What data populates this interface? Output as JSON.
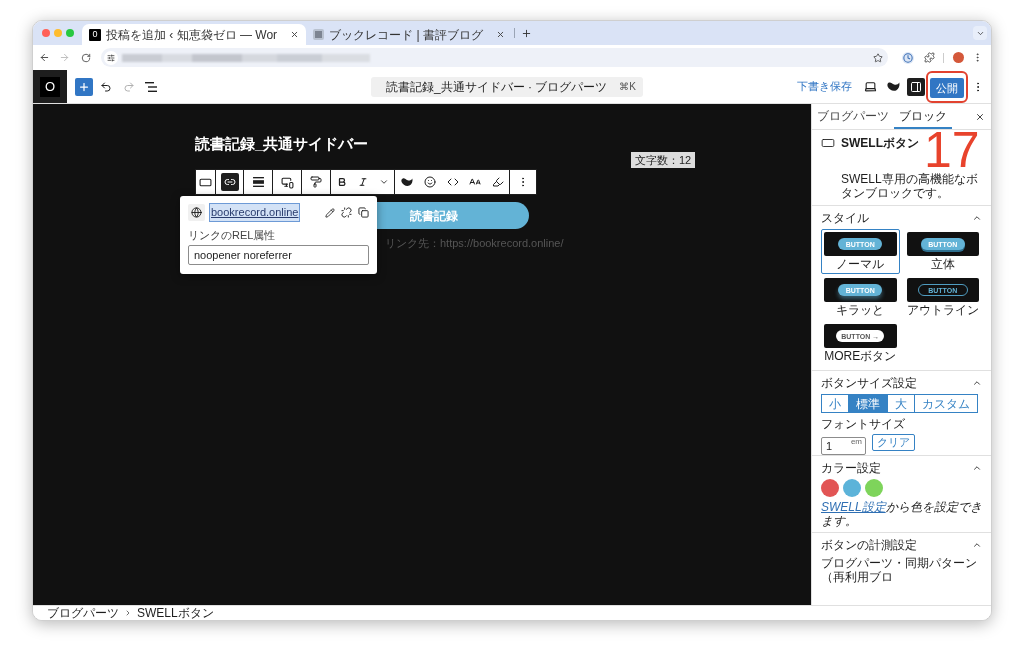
{
  "browser": {
    "tabs": [
      {
        "title": "投稿を追加 ‹ 知恵袋ゼロ — Wor",
        "favicon_text": "0",
        "selected": true
      },
      {
        "title": "ブックレコード | 書評ブログ",
        "selected": false
      }
    ],
    "forward_disabled": true
  },
  "editor_header": {
    "site_icon_text": "O",
    "redo_disabled": true,
    "command_bar": {
      "title": "読書記録_共通サイドバー · ブログパーツ",
      "shortcut": "⌘K"
    },
    "save_draft": "下書き保存",
    "sidebar_toggle": {
      "pressed": true
    },
    "publish": "公開"
  },
  "canvas": {
    "title": "読書記録_共通サイドバー",
    "char_count": "文字数：12",
    "toolbar": {
      "link_pressed": true
    },
    "button": {
      "label": "読書記録"
    },
    "link_caption": "リンク先：https://bookrecord.online/",
    "link_popover": {
      "url": "bookrecord.online",
      "rel_label": "リンクのREL属性",
      "rel_value": "noopener noreferrer"
    }
  },
  "sidebar": {
    "tabs": [
      {
        "label": "ブログパーツ",
        "selected": false
      },
      {
        "label": "ブロック",
        "selected": true
      }
    ],
    "block": {
      "name": "SWELLボタン",
      "description": "SWELL専用の高機能なボタンブロックです。"
    },
    "panels": [
      {
        "kind": "styles",
        "title": "スタイル",
        "expanded": true,
        "styles": [
          {
            "kind": "normal",
            "label": "ノーマル",
            "preview_text": "BUTTON",
            "selected": true
          },
          {
            "kind": "solid",
            "label": "立体",
            "preview_text": "BUTTON",
            "selected": false
          },
          {
            "kind": "shine",
            "label": "キラッと",
            "preview_text": "BUTTON",
            "selected": false
          },
          {
            "kind": "outline",
            "label": "アウトライン",
            "preview_text": "BUTTON",
            "selected": false
          },
          {
            "kind": "more",
            "label": "MOREボタン",
            "preview_text": "BUTTON →",
            "selected": false
          }
        ]
      },
      {
        "kind": "size",
        "title": "ボタンサイズ設定",
        "expanded": true,
        "sizes": [
          {
            "label": "小",
            "selected": false
          },
          {
            "label": "標準",
            "selected": true
          },
          {
            "label": "大",
            "selected": false
          },
          {
            "label": "カスタム",
            "selected": false
          }
        ],
        "font_size": {
          "label": "フォントサイズ",
          "value": "1",
          "unit": "em",
          "clear": "クリア"
        }
      },
      {
        "kind": "colors",
        "title": "カラー設定",
        "expanded": true,
        "colors": [
          {
            "color": "#e25555"
          },
          {
            "color": "#5cb3d9"
          },
          {
            "color": "#7ed45b"
          }
        ],
        "note_link": "SWELL設定",
        "note_text": "から色を設定できます。"
      },
      {
        "kind": "tracking",
        "title": "ボタンの計測設定",
        "expanded": true,
        "text": "ブログパーツ・同期パターン（再利用ブロ"
      }
    ]
  },
  "breadcrumb": [
    "ブログパーツ",
    "SWELLボタン"
  ],
  "annotations": {
    "step_number": "17",
    "publish_highlighted": true
  }
}
